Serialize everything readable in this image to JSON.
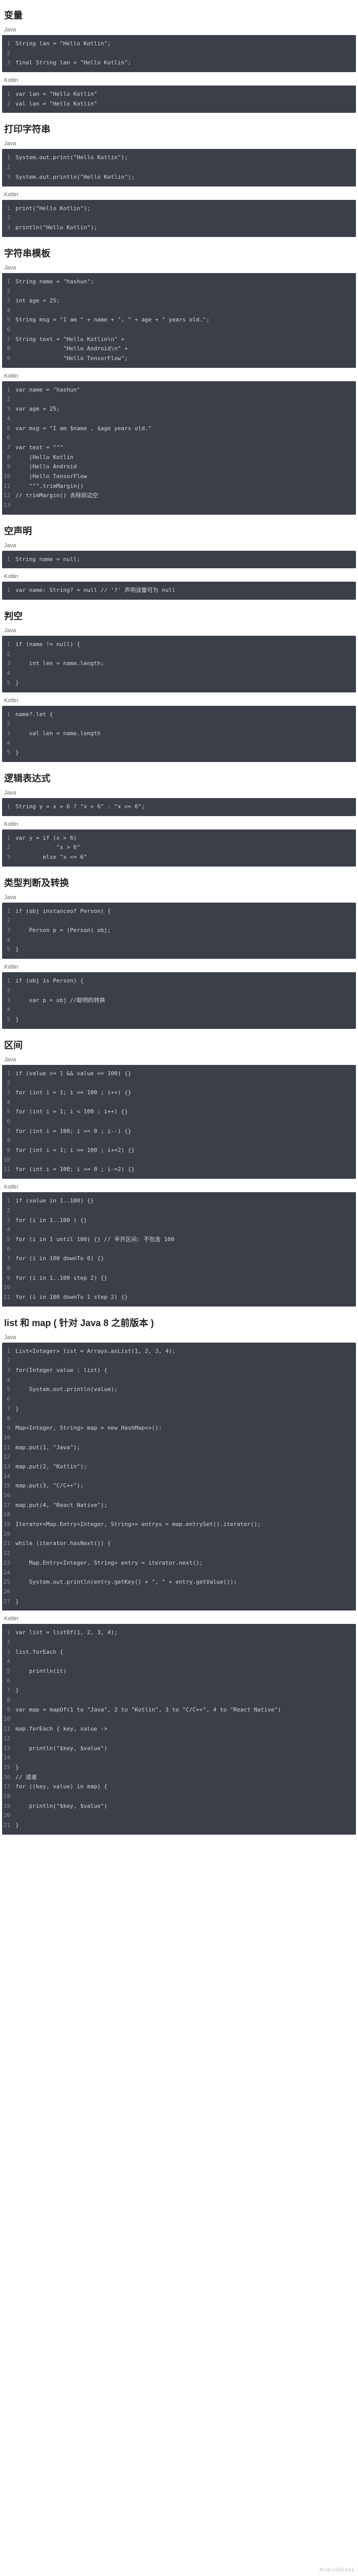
{
  "watermark": "AndroidGeek",
  "sections": [
    {
      "title": "变量",
      "blocks": [
        {
          "lang": "Java",
          "lines": [
            "String lan = \"Hello Kotlin\";",
            "",
            "final String lan = \"Hello Kotlin\";"
          ]
        },
        {
          "lang": "Kotlin",
          "lines": [
            "var lan = \"Hello Kotlin\"",
            "val lan = \"Hello Kotlin\""
          ]
        }
      ]
    },
    {
      "title": "打印字符串",
      "blocks": [
        {
          "lang": "Java",
          "lines": [
            "System.out.print(\"Hello Kotlin\");",
            "",
            "System.out.println(\"Hello Kotlin\");"
          ]
        },
        {
          "lang": "Kotlin",
          "lines": [
            "print(\"Hello Kotlin\");",
            "",
            "println(\"Hello Kotlin\");"
          ]
        }
      ]
    },
    {
      "title": "字符串模板",
      "blocks": [
        {
          "lang": "Java",
          "lines": [
            "String name = \"hashun\";",
            "",
            "int age = 25;",
            "",
            "String msg = \"I am \" + name + \", \" + age + \" years old.\";",
            "",
            "String text = \"Hello Kotlin\\n\" +",
            "              \"Hello Android\\n\" +",
            "              \"Hello TensorFlow\";"
          ]
        },
        {
          "lang": "Kotlin",
          "lines": [
            "var name = \"hashun\"",
            "",
            "var age = 25;",
            "",
            "var msg = \"I am $name , $age years old.\"",
            "",
            "var text = \"\"\"",
            "    |Hello Kotlin",
            "    |Hello Android",
            "    |Hello TensorFlow",
            "    \"\"\".trimMargin()",
            "// trimMargin() 去除前边空",
            ""
          ]
        }
      ]
    },
    {
      "title": "空声明",
      "blocks": [
        {
          "lang": "Java",
          "lines": [
            "String name = null;"
          ]
        },
        {
          "lang": "Kotlin",
          "lines": [
            "var name: String? = null // '?' 声明该量可为 null"
          ]
        }
      ]
    },
    {
      "title": "判空",
      "blocks": [
        {
          "lang": "Java",
          "lines": [
            "if (name != null) {",
            "",
            "    int len = name.length;",
            "",
            "}"
          ]
        },
        {
          "lang": "Kotlin",
          "lines": [
            "name?.let {",
            "",
            "    val len = name.length",
            "",
            "}"
          ]
        }
      ]
    },
    {
      "title": "逻辑表达式",
      "blocks": [
        {
          "lang": "Java",
          "lines": [
            "String y = x > 6 ? \"x > 6\" : \"x <= 6\";"
          ]
        },
        {
          "lang": "Kotlin",
          "lines": [
            "var y = if (x > 6)",
            "            \"x > 6\"",
            "        else \"x <= 6\""
          ]
        }
      ]
    },
    {
      "title": "类型判断及转换",
      "blocks": [
        {
          "lang": "Java",
          "lines": [
            "if (obj instanceof Person) {",
            "",
            "    Person p = (Person) obj;",
            "",
            "}"
          ]
        },
        {
          "lang": "Kotlin",
          "lines": [
            "if (obj is Person) {",
            "",
            "    var p = obj //聪明的转换",
            "",
            "}"
          ]
        }
      ]
    },
    {
      "title": "区间",
      "blocks": [
        {
          "lang": "Java",
          "lines": [
            "if (value >= 1 && value <= 100) {}",
            "",
            "for (int i = 1; i <= 100 ; i++) {}",
            "",
            "for (int i = 1; i < 100 ; i++) {}",
            "",
            "for (int i = 100; i >= 0 ; i--) {}",
            "",
            "for (int i = 1; i <= 100 ; i+=2) {}",
            "",
            "for (int i = 100; i >= 0 ; i-=2) {}"
          ]
        },
        {
          "lang": "Kotlin",
          "lines": [
            "if (value in 1..100) {}",
            "",
            "for (i in 1..100 ) {}",
            "",
            "for (i in 1 until 100) {} // 半开区间: 不包含 100",
            "",
            "for (i in 100 downTo 0) {}",
            "",
            "for (i in 1..100 step 2) {}",
            "",
            "for (i in 100 downTo 1 step 2) {}"
          ]
        }
      ]
    },
    {
      "title": "list 和 map ( 针对 Java 8 之前版本 )",
      "blocks": [
        {
          "lang": "Java",
          "lines": [
            "List<Integer> list = Arrays.asList(1, 2, 3, 4);",
            "",
            "for(Integer value : list) {",
            "",
            "    System.out.println(value);",
            "",
            "}",
            "",
            "Map<Integer, String> map = new HashMap<>();",
            "",
            "map.put(1, \"Java\");",
            "",
            "map.put(2, \"Kotlin\");",
            "",
            "map.put(3, \"C/C++\");",
            "",
            "map.put(4, \"React Native\");",
            "",
            "Iterator<Map.Entry<Integer, String>> entrys = map.entrySet().iterator();",
            "",
            "while (iterator.hasNext()) {",
            "",
            "    Map.Entry<Integer, String> entry = iterator.next();",
            "",
            "    System.out.println(entry.getKey() + \", \" + entry.getValue());",
            "",
            "}"
          ]
        },
        {
          "lang": "Kotlin",
          "lines": [
            "var list = listOf(1, 2, 3, 4);",
            "",
            "list.forEach {",
            "",
            "    println(it)",
            "",
            "}",
            "",
            "var map = mapOf(1 to \"Java\", 2 to \"Kotlin\", 3 to \"C/C++\", 4 to \"React Native\")",
            "",
            "map.forEach { key, value ->",
            "",
            "    println(\"$key, $value\")",
            "",
            "}",
            "// 或者",
            "for ((key, value) in map) {",
            "",
            "    println(\"$key, $value\")",
            "",
            "}"
          ]
        }
      ]
    }
  ]
}
